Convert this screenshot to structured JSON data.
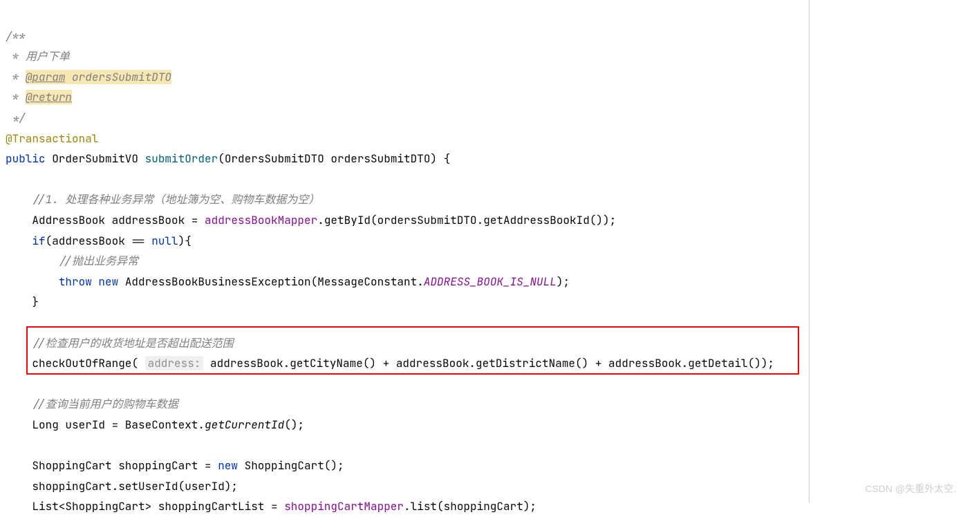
{
  "code": {
    "line1": "/**",
    "line2_prefix": " * ",
    "line2_text": "用户下单",
    "line3_prefix": " * ",
    "line3_tag": "@param",
    "line3_param": " ordersSubmitDTO",
    "line4_prefix": " * ",
    "line4_tag": "@return",
    "line5": " */",
    "line6": "@Transactional",
    "line7_public": "public",
    "line7_type": " OrderSubmitVO ",
    "line7_method": "submitOrder",
    "line7_params": "(OrdersSubmitDTO ordersSubmitDTO) {",
    "line8": "",
    "line9": "    //1. 处理各种业务异常（地址簿为空、购物车数据为空）",
    "line10_pre": "    AddressBook addressBook = ",
    "line10_field": "addressBookMapper",
    "line10_post": ".getById(ordersSubmitDTO.getAddressBookId());",
    "line11_pre": "    ",
    "line11_if": "if",
    "line11_cond": "(addressBook == ",
    "line11_null": "null",
    "line11_brace": "){",
    "line12": "        //抛出业务异常",
    "line13_pre": "        ",
    "line13_throw": "throw new ",
    "line13_ex": "AddressBookBusinessException(MessageConstant.",
    "line13_const": "ADDRESS_BOOK_IS_NULL",
    "line13_end": ");",
    "line14": "    }",
    "line15": "",
    "line16": "    //检查用户的收货地址是否超出配送范围",
    "line17_pre": "    checkOutOfRange( ",
    "line17_hint": "address:",
    "line17_post": " addressBook.getCityName() + addressBook.getDistrictName() + addressBook.getDetail());",
    "line18": "",
    "line19": "    //查询当前用户的购物车数据",
    "line20_pre": "    Long userId = BaseContext.",
    "line20_method": "getCurrentId",
    "line20_end": "();",
    "line21": "",
    "line22_pre": "    ShoppingCart shoppingCart = ",
    "line22_new": "new ",
    "line22_post": "ShoppingCart();",
    "line23": "    shoppingCart.setUserId(userId);",
    "line24_pre": "    List<ShoppingCart> shoppingCartList = ",
    "line24_field": "shoppingCartMapper",
    "line24_post": ".list(shoppingCart);"
  },
  "watermark": "CSDN @失重外太空."
}
